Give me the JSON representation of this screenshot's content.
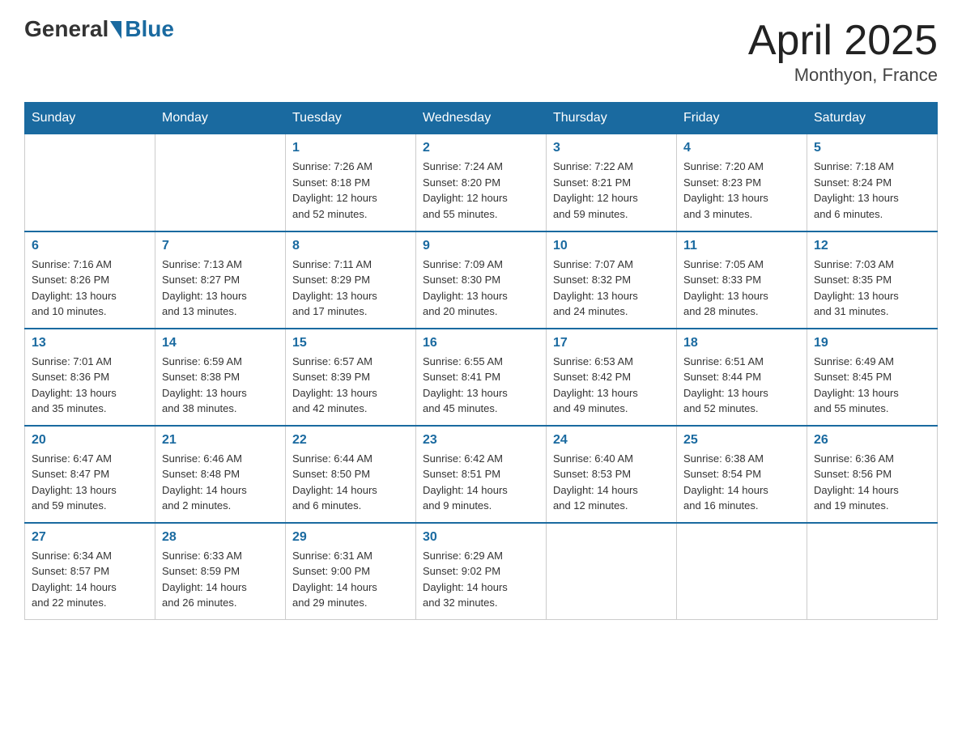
{
  "logo": {
    "general": "General",
    "blue": "Blue"
  },
  "title": "April 2025",
  "subtitle": "Monthyon, France",
  "weekdays": [
    "Sunday",
    "Monday",
    "Tuesday",
    "Wednesday",
    "Thursday",
    "Friday",
    "Saturday"
  ],
  "weeks": [
    [
      {
        "day": "",
        "info": ""
      },
      {
        "day": "",
        "info": ""
      },
      {
        "day": "1",
        "info": "Sunrise: 7:26 AM\nSunset: 8:18 PM\nDaylight: 12 hours\nand 52 minutes."
      },
      {
        "day": "2",
        "info": "Sunrise: 7:24 AM\nSunset: 8:20 PM\nDaylight: 12 hours\nand 55 minutes."
      },
      {
        "day": "3",
        "info": "Sunrise: 7:22 AM\nSunset: 8:21 PM\nDaylight: 12 hours\nand 59 minutes."
      },
      {
        "day": "4",
        "info": "Sunrise: 7:20 AM\nSunset: 8:23 PM\nDaylight: 13 hours\nand 3 minutes."
      },
      {
        "day": "5",
        "info": "Sunrise: 7:18 AM\nSunset: 8:24 PM\nDaylight: 13 hours\nand 6 minutes."
      }
    ],
    [
      {
        "day": "6",
        "info": "Sunrise: 7:16 AM\nSunset: 8:26 PM\nDaylight: 13 hours\nand 10 minutes."
      },
      {
        "day": "7",
        "info": "Sunrise: 7:13 AM\nSunset: 8:27 PM\nDaylight: 13 hours\nand 13 minutes."
      },
      {
        "day": "8",
        "info": "Sunrise: 7:11 AM\nSunset: 8:29 PM\nDaylight: 13 hours\nand 17 minutes."
      },
      {
        "day": "9",
        "info": "Sunrise: 7:09 AM\nSunset: 8:30 PM\nDaylight: 13 hours\nand 20 minutes."
      },
      {
        "day": "10",
        "info": "Sunrise: 7:07 AM\nSunset: 8:32 PM\nDaylight: 13 hours\nand 24 minutes."
      },
      {
        "day": "11",
        "info": "Sunrise: 7:05 AM\nSunset: 8:33 PM\nDaylight: 13 hours\nand 28 minutes."
      },
      {
        "day": "12",
        "info": "Sunrise: 7:03 AM\nSunset: 8:35 PM\nDaylight: 13 hours\nand 31 minutes."
      }
    ],
    [
      {
        "day": "13",
        "info": "Sunrise: 7:01 AM\nSunset: 8:36 PM\nDaylight: 13 hours\nand 35 minutes."
      },
      {
        "day": "14",
        "info": "Sunrise: 6:59 AM\nSunset: 8:38 PM\nDaylight: 13 hours\nand 38 minutes."
      },
      {
        "day": "15",
        "info": "Sunrise: 6:57 AM\nSunset: 8:39 PM\nDaylight: 13 hours\nand 42 minutes."
      },
      {
        "day": "16",
        "info": "Sunrise: 6:55 AM\nSunset: 8:41 PM\nDaylight: 13 hours\nand 45 minutes."
      },
      {
        "day": "17",
        "info": "Sunrise: 6:53 AM\nSunset: 8:42 PM\nDaylight: 13 hours\nand 49 minutes."
      },
      {
        "day": "18",
        "info": "Sunrise: 6:51 AM\nSunset: 8:44 PM\nDaylight: 13 hours\nand 52 minutes."
      },
      {
        "day": "19",
        "info": "Sunrise: 6:49 AM\nSunset: 8:45 PM\nDaylight: 13 hours\nand 55 minutes."
      }
    ],
    [
      {
        "day": "20",
        "info": "Sunrise: 6:47 AM\nSunset: 8:47 PM\nDaylight: 13 hours\nand 59 minutes."
      },
      {
        "day": "21",
        "info": "Sunrise: 6:46 AM\nSunset: 8:48 PM\nDaylight: 14 hours\nand 2 minutes."
      },
      {
        "day": "22",
        "info": "Sunrise: 6:44 AM\nSunset: 8:50 PM\nDaylight: 14 hours\nand 6 minutes."
      },
      {
        "day": "23",
        "info": "Sunrise: 6:42 AM\nSunset: 8:51 PM\nDaylight: 14 hours\nand 9 minutes."
      },
      {
        "day": "24",
        "info": "Sunrise: 6:40 AM\nSunset: 8:53 PM\nDaylight: 14 hours\nand 12 minutes."
      },
      {
        "day": "25",
        "info": "Sunrise: 6:38 AM\nSunset: 8:54 PM\nDaylight: 14 hours\nand 16 minutes."
      },
      {
        "day": "26",
        "info": "Sunrise: 6:36 AM\nSunset: 8:56 PM\nDaylight: 14 hours\nand 19 minutes."
      }
    ],
    [
      {
        "day": "27",
        "info": "Sunrise: 6:34 AM\nSunset: 8:57 PM\nDaylight: 14 hours\nand 22 minutes."
      },
      {
        "day": "28",
        "info": "Sunrise: 6:33 AM\nSunset: 8:59 PM\nDaylight: 14 hours\nand 26 minutes."
      },
      {
        "day": "29",
        "info": "Sunrise: 6:31 AM\nSunset: 9:00 PM\nDaylight: 14 hours\nand 29 minutes."
      },
      {
        "day": "30",
        "info": "Sunrise: 6:29 AM\nSunset: 9:02 PM\nDaylight: 14 hours\nand 32 minutes."
      },
      {
        "day": "",
        "info": ""
      },
      {
        "day": "",
        "info": ""
      },
      {
        "day": "",
        "info": ""
      }
    ]
  ]
}
